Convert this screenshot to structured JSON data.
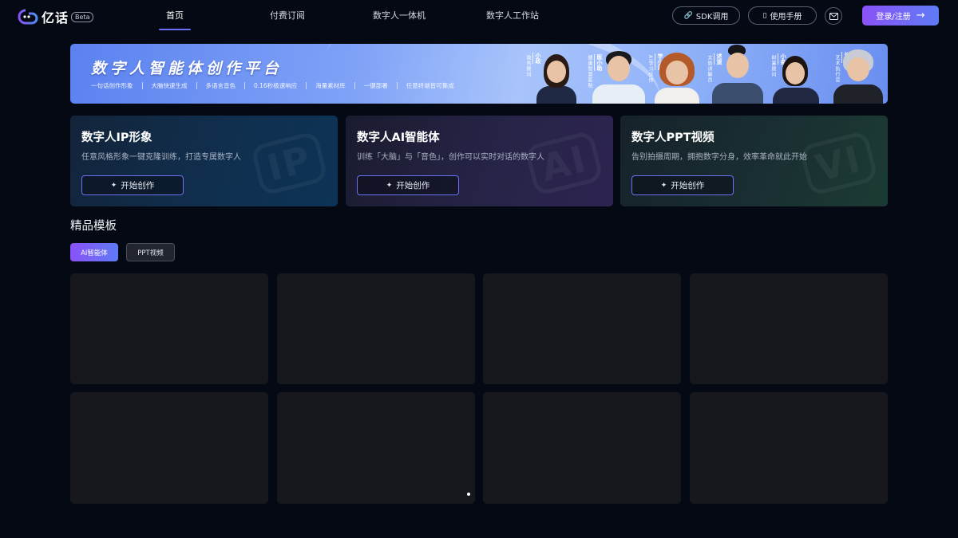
{
  "header": {
    "logo_text": "亿话",
    "beta": "Beta",
    "nav": [
      {
        "label": "首页",
        "active": true
      },
      {
        "label": "付费订阅",
        "active": false
      },
      {
        "label": "数字人一体机",
        "active": false
      },
      {
        "label": "数字人工作站",
        "active": false
      }
    ],
    "sdk_label": "SDK调用",
    "manual_label": "使用手册",
    "login_label": "登录/注册"
  },
  "banner": {
    "title": "数字人智能体创作平台",
    "features": [
      "一句话创作形象",
      "大脑快速生成",
      "多语言音色",
      "0.16秒极速响应",
      "海量素材库",
      "一键部署",
      "任意终端皆可集成"
    ],
    "personas": [
      {
        "name": "小政",
        "tag": "政务顾问"
      },
      {
        "name": "医小助",
        "tag": "健康智慧医院"
      },
      {
        "name": "学小涵",
        "tag": "AI学习伙伴"
      },
      {
        "name": "述道",
        "tag": "文旅讲解员"
      },
      {
        "name": "小金",
        "tag": "财富顾问"
      },
      {
        "name": "幻星",
        "tag": "艺术执行官"
      }
    ]
  },
  "cards": [
    {
      "title": "数字人IP形象",
      "desc": "任意风格形象一键克隆训练，打造专属数字人",
      "button": "开始创作",
      "watermark": "IP"
    },
    {
      "title": "数字人AI智能体",
      "desc": "训练「大脑」与「音色」，创作可以实时对话的数字人",
      "button": "开始创作",
      "watermark": "AI"
    },
    {
      "title": "数字人PPT视频",
      "desc": "告别拍摄周期，拥抱数字分身，效率革命就此开始",
      "button": "开始创作",
      "watermark": "VI"
    }
  ],
  "templates": {
    "title": "精品模板",
    "filters": [
      {
        "label": "AI智能体",
        "active": true
      },
      {
        "label": "PPT视频",
        "active": false
      }
    ]
  }
}
